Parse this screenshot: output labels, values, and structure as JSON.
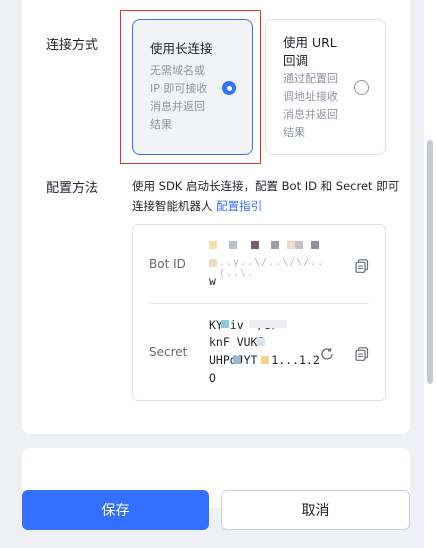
{
  "connection": {
    "label": "连接方式",
    "option_long": {
      "title": "使用长连接",
      "desc_lines": [
        "无需域名或",
        "IP 即可接收",
        "消息并返回",
        "结果"
      ],
      "selected": true
    },
    "option_url": {
      "title_lines": [
        "使用 URL",
        "回调"
      ],
      "desc_lines": [
        "通过配置回",
        "调地址接收",
        "消息并返回",
        "结果"
      ],
      "selected": false
    }
  },
  "config": {
    "label": "配置方法",
    "desc": "使用 SDK 启动长连接，配置 Bot ID 和 Secret 即可连接智能机器人 ",
    "link": "配置指引"
  },
  "credentials": {
    "bot_id": {
      "label": "Bot ID",
      "value_lines": [
        "",
        "w"
      ]
    },
    "secret": {
      "label": "Secret",
      "value_lines": [
        "KY  iv      '/SF",
        "knF   VUKI",
        "UHPdJYT    .1...1.2",
        "O"
      ]
    }
  },
  "actions": {
    "save": "保存",
    "cancel": "取消"
  },
  "colors": {
    "primary": "#3370ff",
    "annotation": "#d9372b"
  },
  "icons": {
    "copy": "copy-icon",
    "refresh": "refresh-icon"
  }
}
